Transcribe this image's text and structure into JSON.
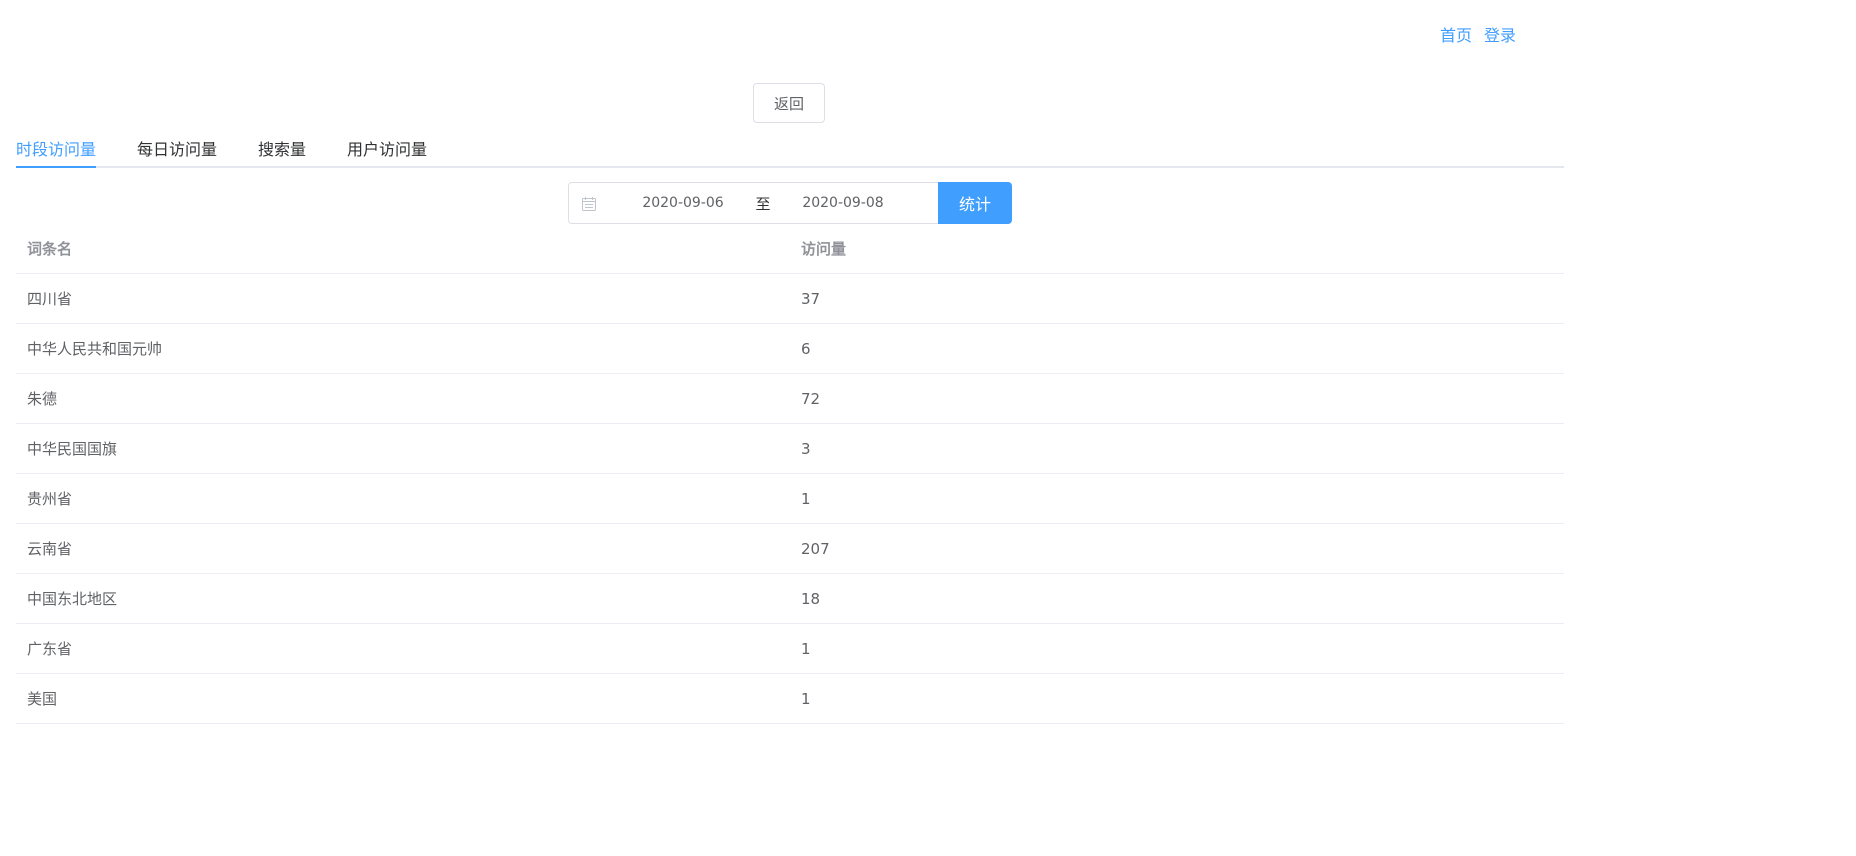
{
  "nav": {
    "home": "首页",
    "login": "登录"
  },
  "back_button": "返回",
  "tabs": [
    {
      "label": "时段访问量",
      "active": true
    },
    {
      "label": "每日访问量",
      "active": false
    },
    {
      "label": "搜索量",
      "active": false
    },
    {
      "label": "用户访问量",
      "active": false
    }
  ],
  "date_range": {
    "start": "2020-09-06",
    "separator": "至",
    "end": "2020-09-08"
  },
  "stat_button": "统计",
  "table": {
    "columns": [
      "词条名",
      "访问量"
    ],
    "rows": [
      {
        "name": "四川省",
        "count": "37"
      },
      {
        "name": "中华人民共和国元帅",
        "count": "6"
      },
      {
        "name": "朱德",
        "count": "72"
      },
      {
        "name": "中华民国国旗",
        "count": "3"
      },
      {
        "name": "贵州省",
        "count": "1"
      },
      {
        "name": "云南省",
        "count": "207"
      },
      {
        "name": "中国东北地区",
        "count": "18"
      },
      {
        "name": "广东省",
        "count": "1"
      },
      {
        "name": "美国",
        "count": "1"
      }
    ]
  },
  "colors": {
    "accent": "#409eff",
    "text": "#606266",
    "header_text": "#909399",
    "border": "#ebeef5"
  }
}
